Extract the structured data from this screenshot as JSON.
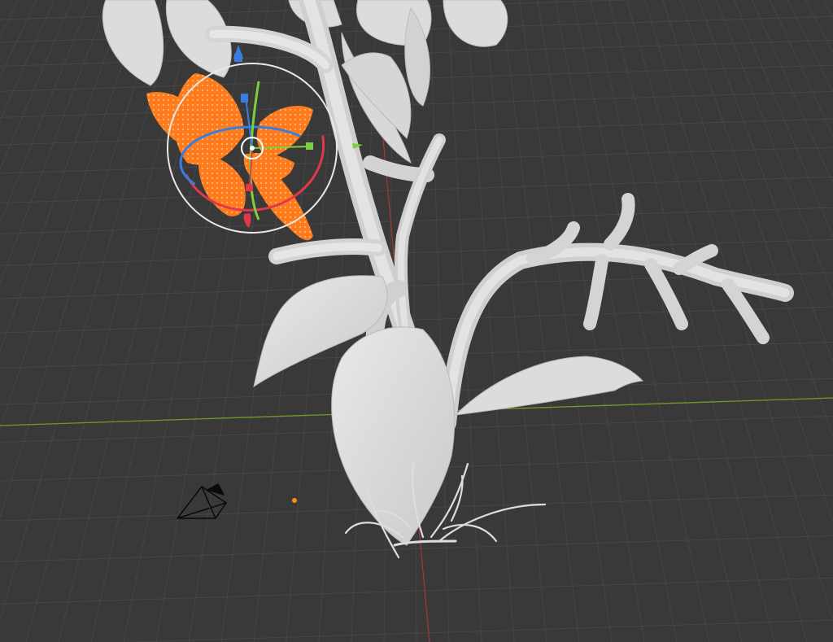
{
  "app": {
    "view": "3d-viewport",
    "shading": "solid",
    "active_tool": "transform"
  },
  "scene": {
    "objects": [
      {
        "name": "plant-stem",
        "kind": "mesh",
        "selected": false
      },
      {
        "name": "flower-top",
        "kind": "mesh",
        "selected": false
      },
      {
        "name": "flower-selected",
        "kind": "mesh",
        "selected": true
      },
      {
        "name": "branch-right",
        "kind": "mesh",
        "selected": false
      },
      {
        "name": "leaves",
        "kind": "mesh",
        "selected": false
      },
      {
        "name": "grass-tufts",
        "kind": "mesh",
        "selected": false
      },
      {
        "name": "camera",
        "kind": "camera",
        "selected": false
      },
      {
        "name": "light",
        "kind": "light",
        "selected": false
      }
    ],
    "grid": {
      "visible": true
    },
    "axes": {
      "x_color": "#6f9a2a",
      "y_color": "#a23a3a"
    }
  },
  "gizmo": {
    "rotate_x_color": "#e0384b",
    "rotate_y_color": "#7bd13a",
    "rotate_z_color": "#3a7ddf",
    "outer_ring_color": "#e8e8e8"
  },
  "colors": {
    "background": "#393939",
    "grid_line": "#454545",
    "mesh": "#d6d6d6",
    "selection": "#ff7a1a",
    "light_dot": "#ff8c1a"
  }
}
